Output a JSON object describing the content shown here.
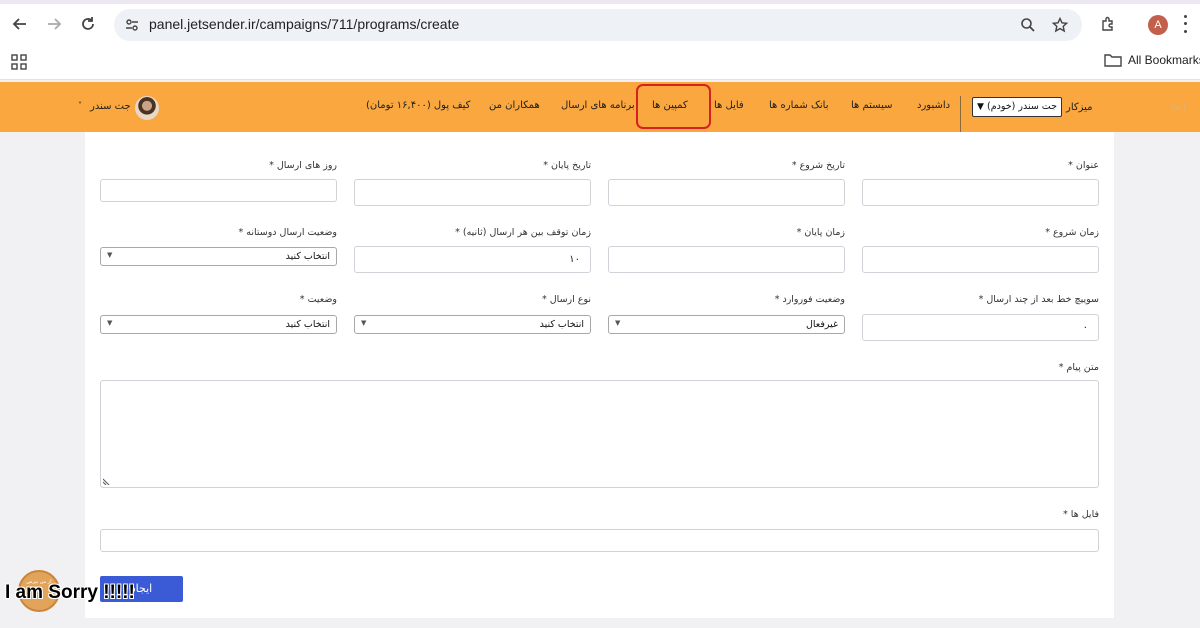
{
  "browser": {
    "url": "panel.jetsender.ir/campaigns/711/programs/create",
    "profile_initial": "A",
    "bookmarks_label": "All Bookmarks"
  },
  "header": {
    "workspace_label": "میزکار",
    "workspace_selected": "جت سندر (خودم)",
    "ghost_text": "ایجا",
    "nav": [
      {
        "label": "داشبورد"
      },
      {
        "label": "سیستم ها"
      },
      {
        "label": "بانک شماره ها"
      },
      {
        "label": "فایل ها"
      },
      {
        "label": "کمپین ها",
        "active": true
      },
      {
        "label": "برنامه های ارسال"
      },
      {
        "label": "همکاران من"
      },
      {
        "label": "کیف پول (۱۶,۴۰۰ تومان)"
      }
    ],
    "user_name": "جت سندر"
  },
  "form": {
    "title_label": "عنوان *",
    "start_date_label": "تاریخ شروع *",
    "end_date_label": "تاریخ پایان *",
    "send_days_label": "روز های ارسال *",
    "start_time_label": "زمان شروع *",
    "end_time_label": "زمان پایان *",
    "pause_label": "زمان توقف بین هر ارسال (ثانیه) *",
    "pause_value": "۱۰",
    "friendly_label": "وضعیت ارسال دوستانه *",
    "friendly_value": "انتخاب کنید",
    "switch_label": "سوییچ خط بعد از چند ارسال *",
    "switch_value": "۰",
    "forward_label": "وضعیت فوروارد *",
    "forward_value": "غیرفعال",
    "send_type_label": "نوع ارسال *",
    "send_type_value": "انتخاب کنید",
    "status_label": "وضعیت *",
    "status_value": "انتخاب کنید",
    "message_label": "متن پیام *",
    "files_label": "فایل ها *",
    "submit_label": "ایجاد"
  },
  "overlay": {
    "badge_text": "از من بپرس",
    "caption": "I am Sorry !!!!!"
  },
  "colors": {
    "header_bg": "#f9a73e",
    "active_outline": "#d52121",
    "submit_bg": "#3b5ad6"
  }
}
